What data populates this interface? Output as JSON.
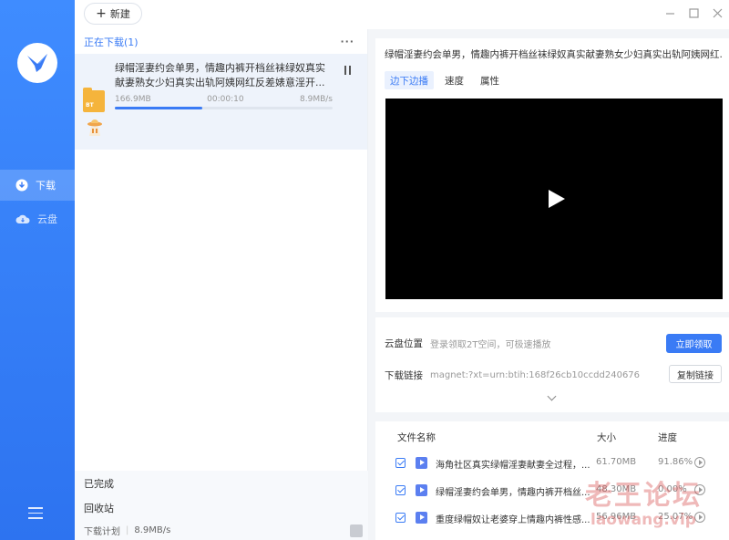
{
  "sidebar": {
    "items": [
      {
        "label": "下载",
        "icon": "download-icon"
      },
      {
        "label": "云盘",
        "icon": "cloud-icon"
      }
    ]
  },
  "topbar": {
    "new_label": "新建"
  },
  "list": {
    "header": "正在下载(1)",
    "task": {
      "title": "绿帽淫妻约会单男，情趣内裤开档丝袜绿奴真实献妻熟女少妇真实出轨阿姨网红反差婊意淫开...",
      "size": "166.9MB",
      "elapsed": "00:00:10",
      "speed": "8.9MB/s",
      "progress": 0.4
    },
    "completed_label": "已完成",
    "recycle_label": "回收站",
    "plan_label": "下载计划",
    "plan_speed": "8.9MB/s"
  },
  "detail": {
    "title": "绿帽淫妻约会单男，情趣内裤开档丝袜绿奴真实献妻熟女少妇真实出轨阿姨网红...",
    "tabs": [
      "边下边播",
      "速度",
      "属性"
    ],
    "cloud_label": "云盘位置",
    "cloud_value": "登录领取2T空间，可极速播放",
    "claim_button": "立即领取",
    "link_label": "下载链接",
    "link_value": "magnet:?xt=urn:btih:168f26cb10ccdd240676...",
    "copy_button": "复制链接"
  },
  "files": {
    "headers": {
      "name": "文件名称",
      "size": "大小",
      "progress": "进度"
    },
    "rows": [
      {
        "name": "海角社区真实绿帽淫妻献妻全过程，...",
        "size": "61.70MB",
        "progress": "91.86%"
      },
      {
        "name": "绿帽淫妻约会单男，情趣内裤开档丝...",
        "size": "48.30MB",
        "progress": "0.00%"
      },
      {
        "name": "重度绿帽奴让老婆穿上情趣内裤性感...",
        "size": "56.96MB",
        "progress": "25.07%"
      }
    ]
  },
  "watermark": {
    "line1": "老王论坛",
    "line2": "laowang.vip"
  },
  "colors": {
    "accent": "#3a7bf5",
    "sidebar": "#3f8cff"
  }
}
